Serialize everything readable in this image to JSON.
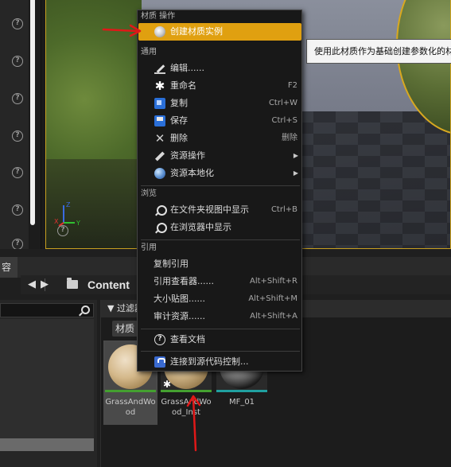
{
  "menu": {
    "section_material_actions": "材质 操作",
    "create_instance": "创建材质实例",
    "section_common": "通用",
    "edit": "编辑......",
    "rename": "重命名",
    "rename_shortcut": "F2",
    "duplicate": "复制",
    "duplicate_shortcut": "Ctrl+W",
    "save": "保存",
    "save_shortcut": "Ctrl+S",
    "delete": "删除",
    "delete_shortcut": "删除",
    "asset_actions": "资源操作",
    "localization": "资源本地化",
    "section_browse": "浏览",
    "show_in_folder": "在文件夹视图中显示",
    "show_in_folder_shortcut": "Ctrl+B",
    "show_in_explorer": "在浏览器中显示",
    "section_references": "引用",
    "copy_reference": "复制引用",
    "reference_viewer": "引用查看器......",
    "reference_viewer_shortcut": "Alt+Shift+R",
    "size_map": "大小贴图......",
    "size_map_shortcut": "Alt+Shift+M",
    "audit_assets": "审计资源......",
    "audit_assets_shortcut": "Alt+Shift+A",
    "view_docs": "查看文档",
    "source_control": "连接到源代码控制..."
  },
  "tooltip": {
    "text": "使用此材质作为基础创建参数化的材"
  },
  "content_browser": {
    "tab_fragment": "容",
    "path": "Content",
    "filter_label": "过滤器",
    "filter_chip": "材质",
    "assets": [
      {
        "name": "GrassAndWood"
      },
      {
        "name": "GrassAndWood_Inst"
      },
      {
        "name": "MF_01"
      }
    ]
  },
  "viewport": {
    "gizmo_x": "X",
    "gizmo_y": "Y",
    "gizmo_z": "Z"
  },
  "icons": {
    "help": "?",
    "star": "✱",
    "delete": "✕",
    "arrow": "▶",
    "back": "◀",
    "forward": "▶",
    "filter": "▼"
  },
  "colors": {
    "menu_highlight": "#e0a010",
    "viewport_border": "#c8a020",
    "annotation_red": "#e01818"
  }
}
